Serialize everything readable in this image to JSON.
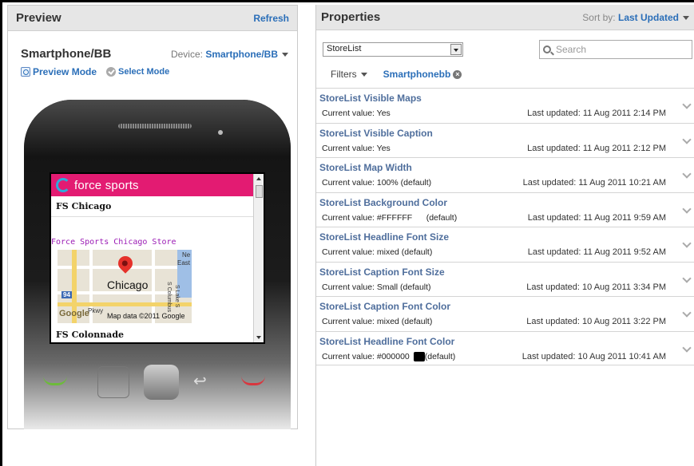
{
  "preview": {
    "title": "Preview",
    "refresh": "Refresh",
    "device_name": "Smartphone/BB",
    "device_label": "Device:",
    "device_value": "Smartphone/BB",
    "modes": [
      "Preview Mode",
      "Select Mode"
    ],
    "screen": {
      "brand": "force sports",
      "store1": "FS Chicago",
      "store_link": "Force Sports Chicago Store",
      "map_city": "Chicago",
      "map_google": "Google",
      "map_data": "Map data ©2011 Google",
      "map_labels": [
        "Ne",
        "East",
        "S Columbus",
        "S Lake S",
        "Pkwy",
        "94"
      ],
      "store2": "FS Colonnade"
    }
  },
  "properties": {
    "title": "Properties",
    "sort_label": "Sort by:",
    "sort_value": "Last Updated",
    "select_value": "StoreList",
    "search_placeholder": "Search",
    "filters_label": "Filters",
    "filter_chip": "Smartphonebb",
    "items": [
      {
        "name": "StoreList Visible Maps",
        "value": "Current value: Yes",
        "updated": "Last updated: 11 Aug 2011 2:14 PM"
      },
      {
        "name": "StoreList Visible Caption",
        "value": "Current value: Yes",
        "updated": "Last updated: 11 Aug 2011 2:12 PM"
      },
      {
        "name": "StoreList Map Width",
        "value": "Current value: 100% (default)",
        "updated": "Last updated: 11 Aug 2011 10:21 AM"
      },
      {
        "name": "StoreList Background Color",
        "value": "Current value: #FFFFFF      (default)",
        "updated": "Last updated: 11 Aug 2011 9:59 AM"
      },
      {
        "name": "StoreList Headline Font Size",
        "value": "Current value: mixed (default)",
        "updated": "Last updated: 11 Aug 2011 9:52 AM"
      },
      {
        "name": "StoreList Caption Font Size",
        "value": "Current value: Small (default)",
        "updated": "Last updated: 10 Aug 2011 3:34 PM"
      },
      {
        "name": "StoreList Caption Font Color",
        "value": "Current value: mixed (default)",
        "updated": "Last updated: 10 Aug 2011 3:22 PM"
      },
      {
        "name": "StoreList Headline Font Color",
        "value_pre": "Current value: #000000",
        "value_post": "(default)",
        "updated": "Last updated: 10 Aug 2011 10:41 AM"
      }
    ]
  },
  "colors": {
    "accent": "#2a6eb8",
    "brand_pink": "#e31b72",
    "item_name": "#4f6e9c"
  }
}
